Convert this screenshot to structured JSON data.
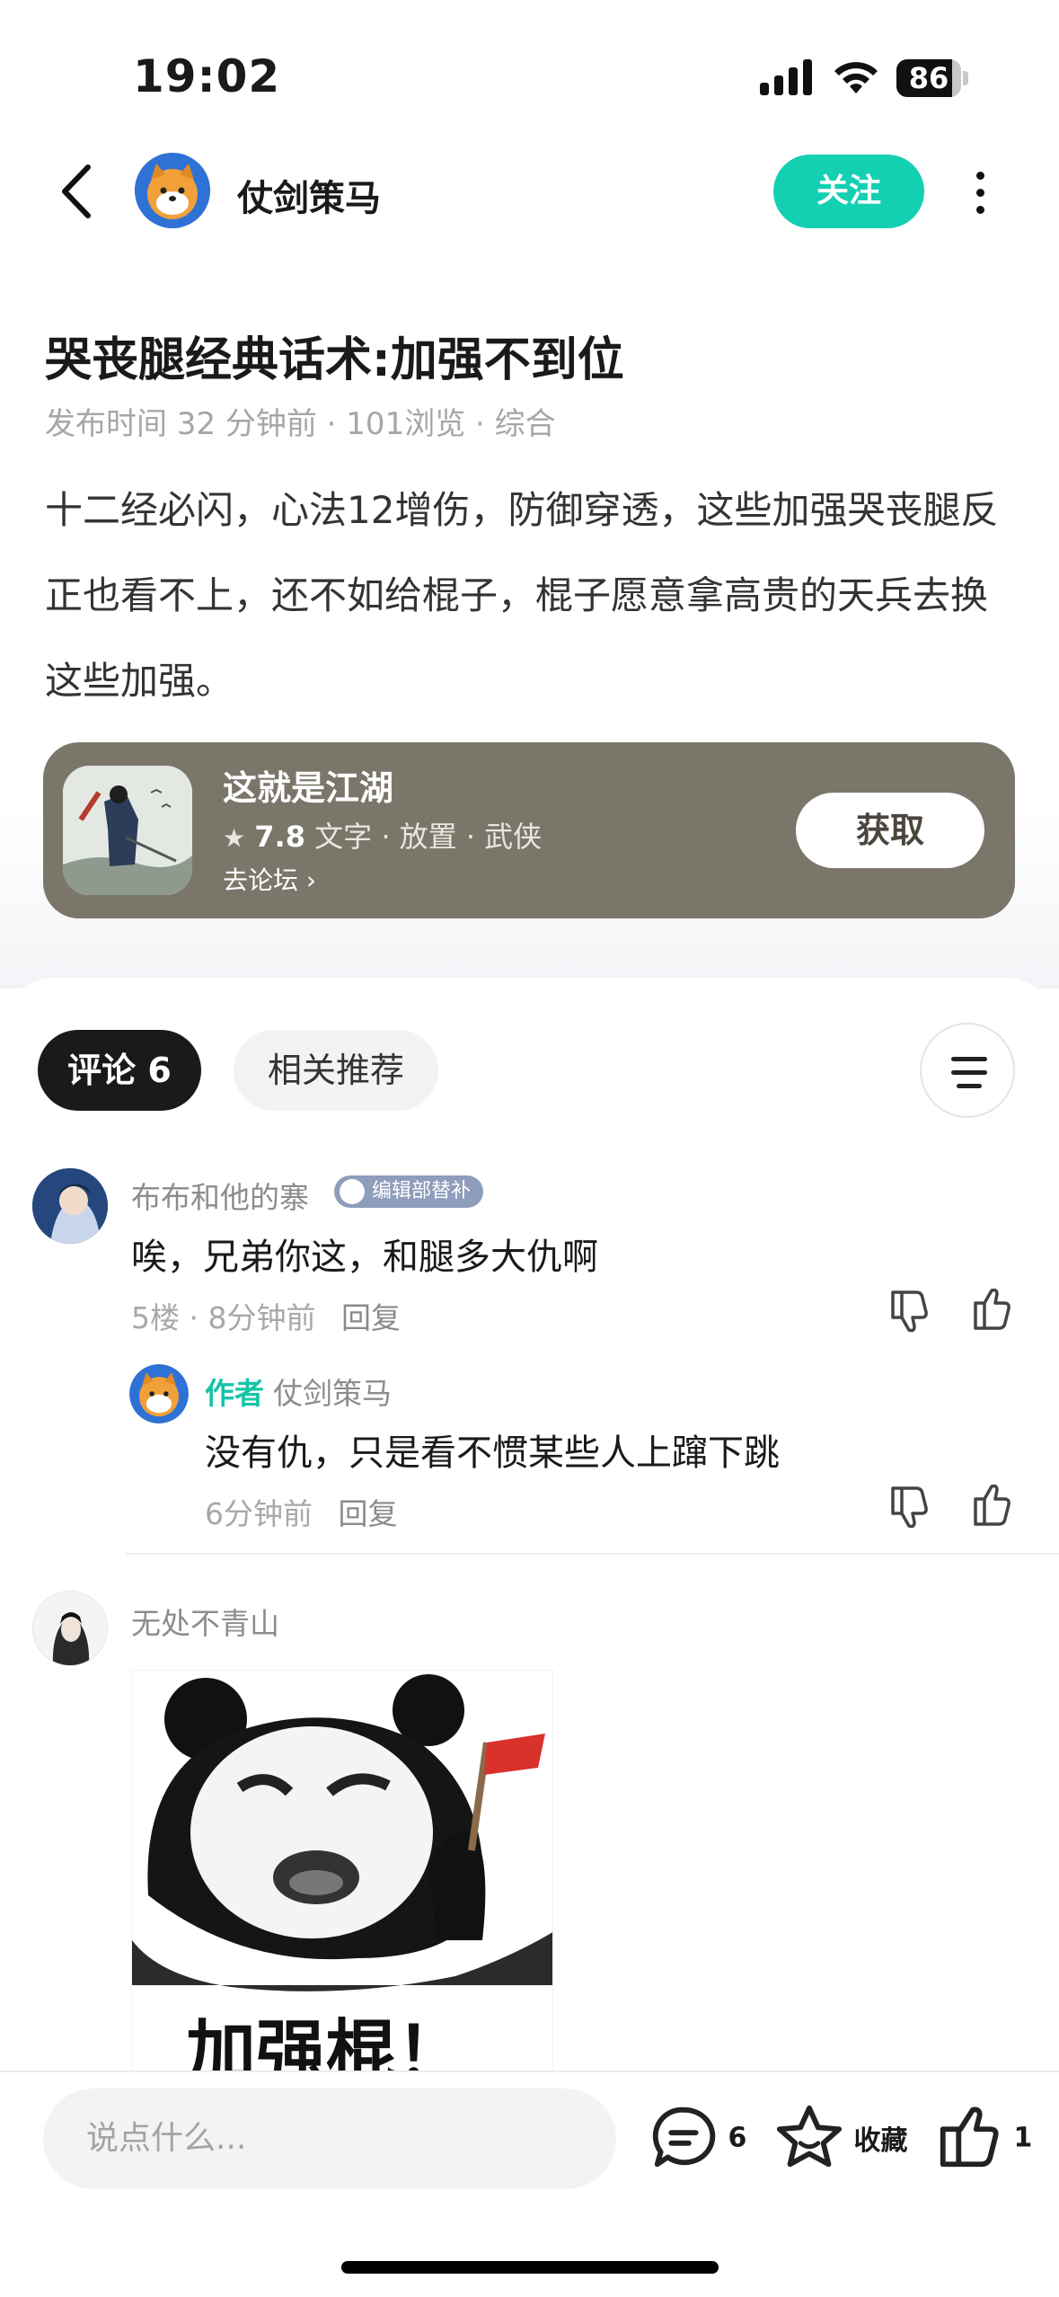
{
  "status_bar": {
    "time": "19:02",
    "battery": "86",
    "battery_level": 0.86
  },
  "header": {
    "username": "仗剑策马",
    "follow_label": "关注"
  },
  "post": {
    "title": "哭丧腿经典话术:加强不到位",
    "meta": "发布时间 32 分钟前 · 101浏览 · 综合",
    "body": "十二经必闪，心法12增伤，防御穿透，这些加强哭丧腿反正也看不上，还不如给棍子，棍子愿意拿高贵的天兵去换这些加强。"
  },
  "game_card": {
    "name": "这就是江湖",
    "rating": "7.8",
    "tags": "文字 · 放置 · 武侠",
    "forum_link": "去论坛",
    "get_label": "获取"
  },
  "tabs": {
    "comments": "评论 6",
    "related": "相关推荐"
  },
  "comments": [
    {
      "user": "布布和他的寨",
      "badge": "编辑部替补",
      "text": "唉，兄弟你这，和腿多大仇啊",
      "meta": "5楼 · 8分钟前",
      "reply_label": "回复",
      "reply": {
        "author_tag": "作者",
        "user": "仗剑策马",
        "text": "没有仇，只是看不惯某些人上蹿下跳",
        "meta": "6分钟前",
        "reply_label": "回复"
      }
    },
    {
      "user": "无处不青山",
      "image_caption": "加强棍！"
    }
  ],
  "bottom_bar": {
    "input_placeholder": "说点什么...",
    "comment_count": "6",
    "favorite_label": "收藏",
    "like_count": "1"
  },
  "colors": {
    "accent": "#14d0b2",
    "card_bg": "#7b766a",
    "badge": "#8e9dbb"
  }
}
